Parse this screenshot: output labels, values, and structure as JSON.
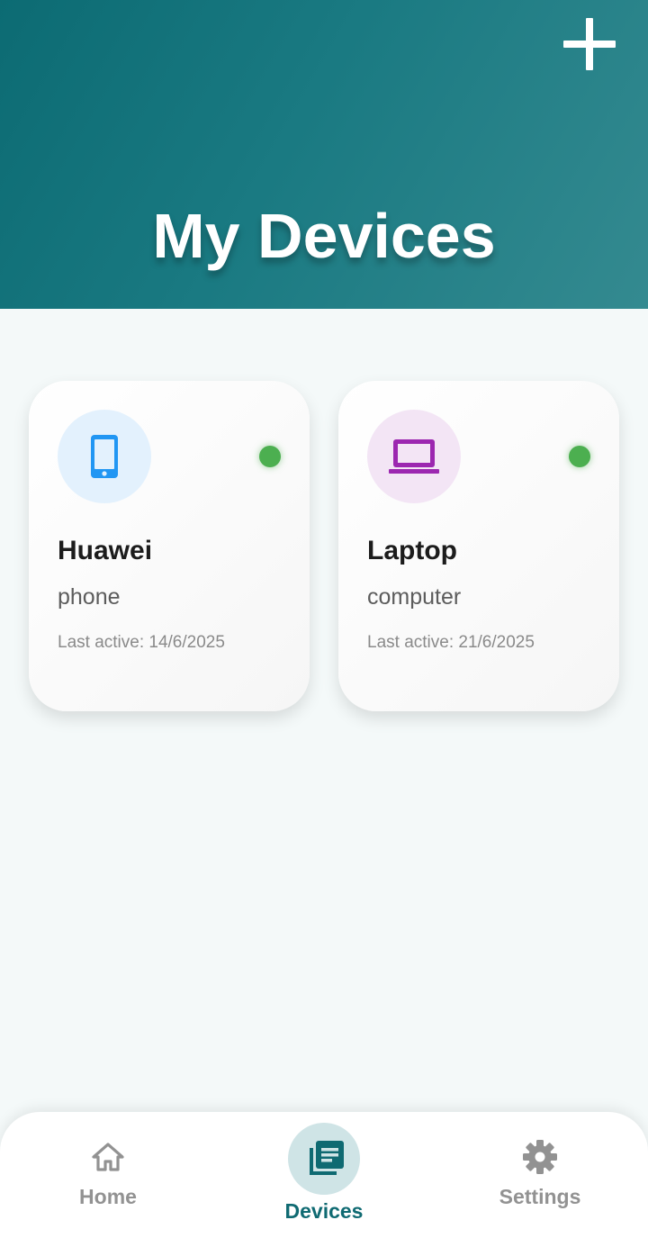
{
  "header": {
    "title": "My Devices",
    "add_icon": "plus-icon"
  },
  "devices": [
    {
      "name": "Huawei",
      "type": "phone",
      "last_active": "Last active: 14/6/2025",
      "icon": "smartphone-icon",
      "icon_color": "#2196f3",
      "icon_bg": "#e3f1fd",
      "status": "online",
      "status_color": "#4caf50"
    },
    {
      "name": "Laptop",
      "type": "computer",
      "last_active": "Last active: 21/6/2025",
      "icon": "laptop-icon",
      "icon_color": "#9c27b0",
      "icon_bg": "#f3e5f5",
      "status": "online",
      "status_color": "#4caf50"
    }
  ],
  "nav": {
    "items": [
      {
        "label": "Home",
        "icon": "home-icon",
        "active": false
      },
      {
        "label": "Devices",
        "icon": "library-books-icon",
        "active": true
      },
      {
        "label": "Settings",
        "icon": "gear-icon",
        "active": false
      }
    ],
    "active_color": "#0f6a72",
    "inactive_color": "#929292"
  },
  "colors": {
    "header_gradient_start": "#0c6b73",
    "header_gradient_end": "#348a90",
    "background": "#f4f9f9"
  }
}
